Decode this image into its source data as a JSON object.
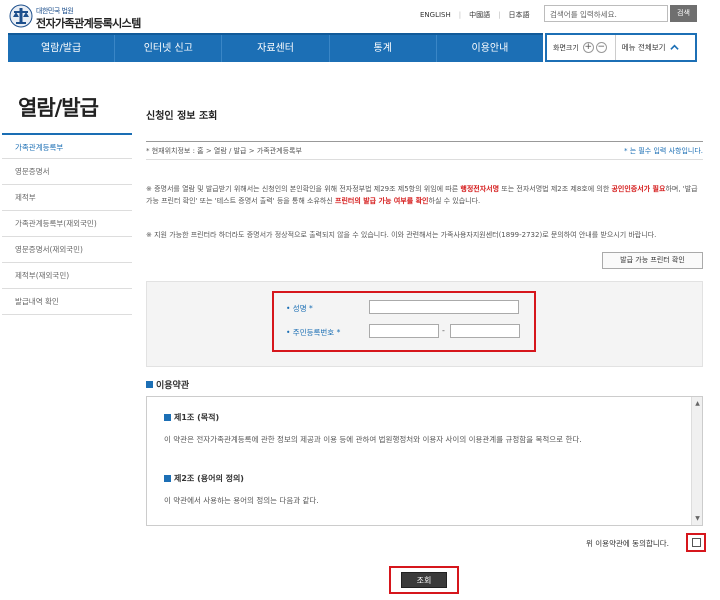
{
  "header": {
    "logo_small": "대한민국 법원",
    "logo_title": "전자가족관계등록시스템",
    "languages": [
      "ENGLISH",
      "中國語",
      "日本語"
    ],
    "search_placeholder": "검색어를 입력하세요.",
    "search_button": "검색"
  },
  "gnb": [
    "열람/발급",
    "인터넷 신고",
    "자료센터",
    "통계",
    "이용안내"
  ],
  "tools": {
    "font_size_label": "화면크기",
    "plus": "+",
    "minus": "−",
    "menu_all": "메뉴 전체보기"
  },
  "sidebar": {
    "title": "열람/발급",
    "items": [
      "가족관계등록부",
      "영문증명서",
      "제적부",
      "가족관계등록부(재외국민)",
      "영문증명서(재외국민)",
      "제적부(재외국민)",
      "발급내역 확인"
    ]
  },
  "main": {
    "title": "신청인 정보 조회",
    "breadcrumb": "* 현재위치정보 : 홈 > 열람 / 발급 > 가족관계등록부",
    "required_note": "* 는 필수 입력 사항입니다.",
    "notice1_a": "※ 증명서를 열람 및 발급받기 위해서는 신청인의 본인확인을 위해 전자정부법 제29조 제5항의 위임에 따른 ",
    "notice1_b": "행정전자서명",
    "notice1_c": " 또는 전자서명법 제2조 제8호에 의한 ",
    "notice1_d": "공인인증서가 필요",
    "notice1_e": "하며, '발급 가능 프린터 확인' 또는 '테스트 증명서 출력' 등을 통해 소유하신 ",
    "notice1_f": "프린터의 발급 가능 여부를 확인",
    "notice1_g": "하실 수 있습니다.",
    "notice2": "※ 지원 가능한 프린터라 하더라도 증명서가 정상적으로 출력되지 않을 수 있습니다. 이와 관련해서는 가족사용자지원센터(1899-2732)로 문의하여 안내를 받으시기 바랍니다.",
    "printer_button": "발급 가능 프린터 확인",
    "form": {
      "name_label": "• 성명 *",
      "rrn_label": "• 주민등록번호 *",
      "name_value": "",
      "rrn_front": "",
      "rrn_back": "",
      "dash": "-"
    },
    "terms": {
      "title": "이용약관",
      "art1_title": "제1조 (목적)",
      "art1_body": "이 약관은 전자가족관계등록에 관한 정보의 제공과 이용 등에 관하여 법원행정처와 이용자 사이의 이용관계를 규정함을 목적으로 한다.",
      "art2_title": "제2조 (용어의 정의)",
      "art2_body": "이 약관에서 사용하는 용어의 정의는 다음과 같다."
    },
    "agree_text": "위 이용약관에 동의합니다.",
    "submit": "조회"
  },
  "colors": {
    "primary": "#1c6fb5",
    "highlight": "#d6161c"
  }
}
